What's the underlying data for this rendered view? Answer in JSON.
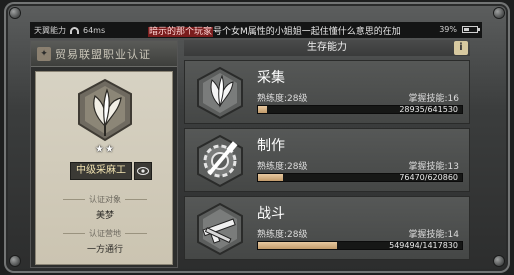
{
  "status_bar": {
    "carrier": "天翼能力",
    "latency": "64ms",
    "marquee_highlight": "暗示的那个玩家",
    "marquee_text": "号个女M属性的小姐姐一起住懂什么意思的在加",
    "battery": "39%"
  },
  "certificate": {
    "header_title": "贸易联盟职业认证",
    "stars": "★★",
    "rank": "中级采麻工",
    "eye_icon": "eye-icon",
    "target_label": "认证对象",
    "target_value": "美梦",
    "place_label": "认证营地",
    "place_value": "一方通行"
  },
  "skills_panel": {
    "title": "生存能力",
    "help_label": "i",
    "skills": [
      {
        "name": "采集",
        "proficiency": "熟练度:28级",
        "mastery": "掌握技能:16",
        "progress_text": "28935/641530",
        "progress": 0.045,
        "icon": "gathering-icon"
      },
      {
        "name": "制作",
        "proficiency": "熟练度:28级",
        "mastery": "掌握技能:13",
        "progress_text": "76470/620860",
        "progress": 0.123,
        "icon": "crafting-icon"
      },
      {
        "name": "战斗",
        "proficiency": "熟练度:28级",
        "mastery": "掌握技能:14",
        "progress_text": "549494/1417830",
        "progress": 0.388,
        "icon": "combat-icon"
      }
    ]
  },
  "colors": {
    "progress_fill": "#d9b687",
    "rank_text": "#f0e2b0",
    "marquee_highlight_bg": "#7a1d1d"
  }
}
